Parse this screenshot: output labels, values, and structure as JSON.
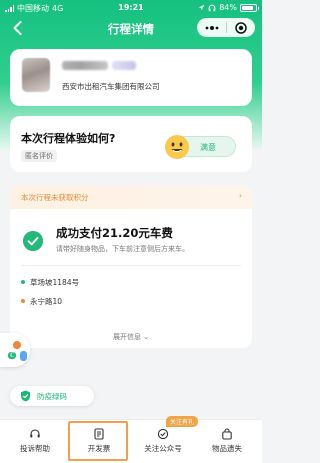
{
  "status_bar": {
    "carrier": "中国移动",
    "network": "4G",
    "time": "19:21",
    "battery_percent": "84%",
    "battery_level": 0.84
  },
  "nav": {
    "title": "行程详情"
  },
  "driver": {
    "company": "西安市出租汽车集团有限公司"
  },
  "rating": {
    "question": "本次行程体验如何?",
    "tag": "匿名评价",
    "button_label": "满意"
  },
  "payment": {
    "banner_text": "本次行程未获取积分",
    "banner_arrow": "›",
    "title": "成功支付21.20元车费",
    "subtitle": "请带好随身物品，下车前注意侧后方来车。",
    "start_address": "草场坡1184号",
    "end_address": "永宁路10",
    "expand_label": "展开信息 ⌄"
  },
  "float_icon": {
    "badge": "ℂ"
  },
  "green_code": {
    "label": "防疫绿码"
  },
  "tabs": [
    {
      "label": "投诉帮助",
      "icon": "headset-icon"
    },
    {
      "label": "开发票",
      "icon": "invoice-icon"
    },
    {
      "label": "关注公众号",
      "icon": "follow-icon"
    },
    {
      "label": "物品遗失",
      "icon": "bag-icon"
    }
  ],
  "tab_badge": "关注有礼",
  "colors": {
    "brand_green": "#16c07f",
    "accent_orange": "#f0a04c",
    "success_green": "#23b97a"
  }
}
